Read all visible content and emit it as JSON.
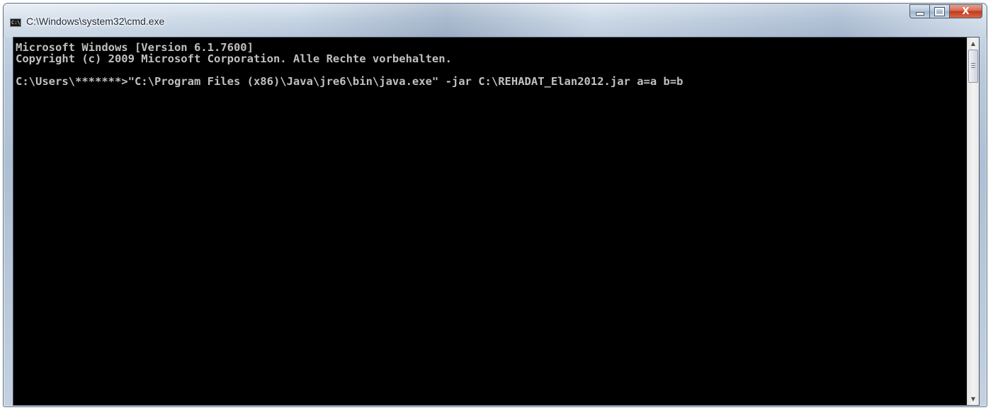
{
  "window": {
    "title": "C:\\Windows\\system32\\cmd.exe",
    "icon": "cmd-icon",
    "icon_text": "C:\\"
  },
  "caption": {
    "minimize_icon": "minimize-icon",
    "maximize_icon": "maximize-icon",
    "close_label": "X"
  },
  "console": {
    "lines": [
      "Microsoft Windows [Version 6.1.7600]",
      "Copyright (c) 2009 Microsoft Corporation. Alle Rechte vorbehalten.",
      "",
      "C:\\Users\\*******>\"C:\\Program Files (x86)\\Java\\jre6\\bin\\java.exe\" -jar C:\\REHADAT_Elan2012.jar a=a b=b"
    ],
    "text_color": "#c0c0c0",
    "background_color": "#000000"
  },
  "scrollbar": {
    "up_icon": "scroll-up-arrow-icon",
    "down_icon": "scroll-down-arrow-icon"
  }
}
